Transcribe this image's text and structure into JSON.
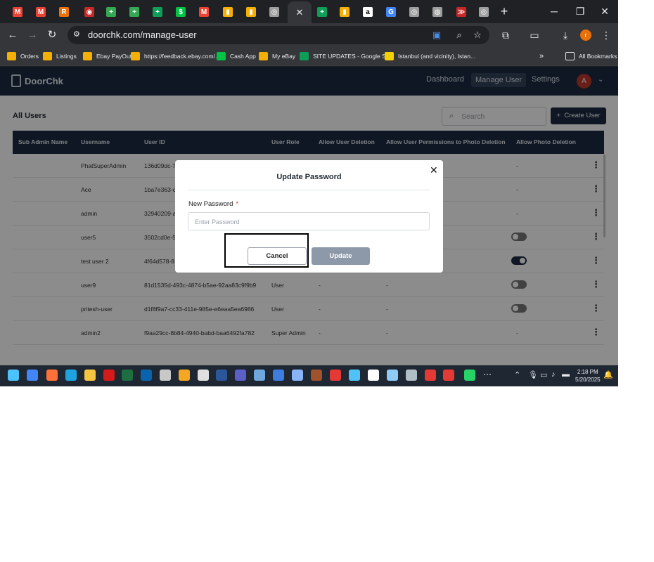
{
  "browser": {
    "tabs": [
      {
        "icon": "gmail-icon",
        "color": "#ea4335",
        "glyph": "M"
      },
      {
        "icon": "gmail-icon",
        "color": "#ea4335",
        "glyph": "M"
      },
      {
        "icon": "app-icon",
        "color": "#e8710a",
        "glyph": "R"
      },
      {
        "icon": "record-icon",
        "color": "#c62828",
        "glyph": "◉"
      },
      {
        "icon": "plus-app-icon",
        "color": "#34a853",
        "glyph": "+"
      },
      {
        "icon": "plus-app-icon",
        "color": "#34a853",
        "glyph": "+"
      },
      {
        "icon": "sheets-icon",
        "color": "#0f9d58",
        "glyph": "+"
      },
      {
        "icon": "cashapp-icon",
        "color": "#00c244",
        "glyph": "$"
      },
      {
        "icon": "gmail-icon",
        "color": "#ea4335",
        "glyph": "M"
      },
      {
        "icon": "ebay-icon",
        "color": "#f5af02",
        "glyph": "▮"
      },
      {
        "icon": "ebay-icon",
        "color": "#f5af02",
        "glyph": "▮"
      },
      {
        "icon": "target-icon",
        "color": "#9e9e9e",
        "glyph": "◎"
      },
      {
        "icon": "close-icon",
        "color": "#35363a",
        "glyph": "✕"
      },
      {
        "icon": "sheets-icon",
        "color": "#0f9d58",
        "glyph": "+"
      },
      {
        "icon": "ebay-icon",
        "color": "#f5af02",
        "glyph": "▮"
      },
      {
        "icon": "amazon-icon",
        "color": "#ffffff",
        "glyph": "a"
      },
      {
        "icon": "google-icon",
        "color": "#4285f4",
        "glyph": "G"
      },
      {
        "icon": "target-icon",
        "color": "#9e9e9e",
        "glyph": "◎"
      },
      {
        "icon": "chrome-icon",
        "color": "#9e9e9e",
        "glyph": "◍"
      },
      {
        "icon": "app-icon",
        "color": "#c62828",
        "glyph": "≫"
      },
      {
        "icon": "target-icon",
        "color": "#9e9e9e",
        "glyph": "◎"
      }
    ],
    "url": "doorchk.com/manage-user",
    "bookmarks": [
      {
        "label": "Orders",
        "color": "#f5af02"
      },
      {
        "label": "Listings",
        "color": "#f5af02"
      },
      {
        "label": "Ebay PayOut",
        "color": "#f5af02"
      },
      {
        "label": "https://feedback.ebay.com/...",
        "color": "#f5af02"
      },
      {
        "label": "Cash App",
        "color": "#00c244"
      },
      {
        "label": "My eBay",
        "color": "#f5af02"
      },
      {
        "label": "SITE UPDATES - Google Sh...",
        "color": "#0f9d58"
      },
      {
        "label": "Istanbul (and vicinity), Istan...",
        "color": "#f5d000"
      }
    ],
    "all_bookmarks": "All Bookmarks",
    "profile_initial": "r"
  },
  "app": {
    "brand": "DoorChk",
    "nav": {
      "dashboard": "Dashboard",
      "manage_user": "Manage User",
      "settings": "Settings"
    },
    "avatar_initial": "A",
    "page_title": "All Users",
    "search_placeholder": "Search",
    "create_user": "Create User",
    "columns": [
      "Sub Admin Name",
      "Username",
      "User ID",
      "User Role",
      "Allow User Deletion",
      "Allow User Permissions to Photo Deletion",
      "Allow Photo Deletion"
    ],
    "rows": [
      {
        "username": "PhatSuperAdmin",
        "user_id": "136d09dc-7",
        "role": "",
        "deletion": "",
        "permissions": "",
        "photo": "-",
        "toggle": null
      },
      {
        "username": "Ace",
        "user_id": "1ba7e363-c",
        "role": "",
        "deletion": "",
        "permissions": "",
        "photo": "-",
        "toggle": null
      },
      {
        "username": "admin",
        "user_id": "32940209-a",
        "role": "",
        "deletion": "",
        "permissions": "",
        "photo": "-",
        "toggle": null
      },
      {
        "username": "user5",
        "user_id": "3502cd0e-5",
        "role": "",
        "deletion": "",
        "permissions": "",
        "photo": "",
        "toggle": false
      },
      {
        "username": "test user 2",
        "user_id": "4f64d578-8",
        "role": "",
        "deletion": "",
        "permissions": "",
        "photo": "",
        "toggle": true
      },
      {
        "username": "user9",
        "user_id": "81d1535d-493c-4874-b5ae-92aa83c9f9b9",
        "role": "User",
        "deletion": "-",
        "permissions": "-",
        "photo": "",
        "toggle": false
      },
      {
        "username": "pritesh-user",
        "user_id": "d1f8f9a7-cc33-411e-985e-e6eaa5ea6986",
        "role": "User",
        "deletion": "-",
        "permissions": "-",
        "photo": "",
        "toggle": false
      },
      {
        "username": "admin2",
        "user_id": "f9aa29cc-8b84-4940-babd-baa6492fa782",
        "role": "Super Admin",
        "deletion": "-",
        "permissions": "-",
        "photo": "-",
        "toggle": null
      }
    ]
  },
  "modal": {
    "title": "Update Password",
    "label": "New Password",
    "required_mark": "*",
    "placeholder": "Enter Password",
    "cancel": "Cancel",
    "update": "Update"
  },
  "taskbar": {
    "time": "2:18 PM",
    "date": "5/20/2025"
  }
}
